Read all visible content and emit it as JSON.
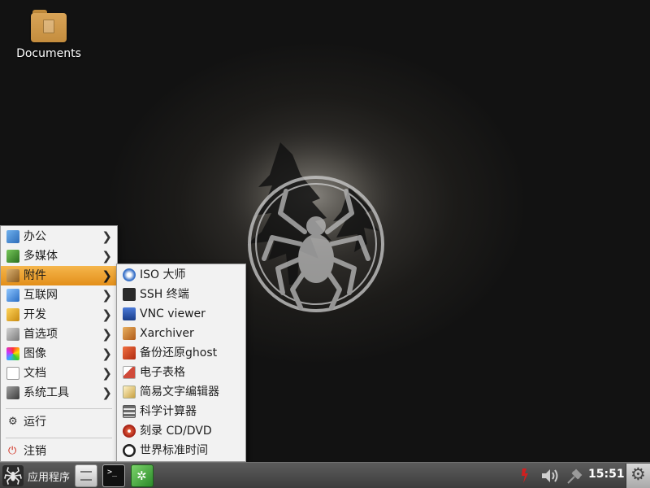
{
  "desktop": {
    "icons": [
      {
        "label": "Documents",
        "icon": "folder-icon"
      }
    ]
  },
  "main_menu": {
    "items": [
      {
        "label": "办公",
        "icon": "office-icon",
        "color": "#3a7bc8",
        "has_submenu": true
      },
      {
        "label": "多媒体",
        "icon": "multimedia-icon",
        "color": "#3a8a2e",
        "has_submenu": true
      },
      {
        "label": "附件",
        "icon": "accessories-icon",
        "color": "#9a6a2a",
        "has_submenu": true,
        "active": true
      },
      {
        "label": "互联网",
        "icon": "internet-icon",
        "color": "#3b86d6",
        "has_submenu": true
      },
      {
        "label": "开发",
        "icon": "development-icon",
        "color": "#e0a020",
        "has_submenu": true
      },
      {
        "label": "首选项",
        "icon": "preferences-icon",
        "color": "#8a8a8a",
        "has_submenu": true
      },
      {
        "label": "图像",
        "icon": "graphics-icon",
        "color": "#c83ad0",
        "has_submenu": true
      },
      {
        "label": "文档",
        "icon": "documents-icon",
        "color": "#bdbdbd",
        "has_submenu": true
      },
      {
        "label": "系统工具",
        "icon": "system-tools-icon",
        "color": "#555555",
        "has_submenu": true
      }
    ],
    "run": {
      "label": "运行",
      "icon": "gear-icon"
    },
    "logout": {
      "label": "注销",
      "icon": "power-icon"
    }
  },
  "submenu": {
    "items": [
      {
        "label": "ISO 大师",
        "icon": "iso-master-icon",
        "color": "#3a72c8"
      },
      {
        "label": "SSH 终端",
        "icon": "ssh-terminal-icon",
        "color": "#333333"
      },
      {
        "label": "VNC viewer",
        "icon": "vnc-viewer-icon",
        "color": "#1f4fa8"
      },
      {
        "label": "Xarchiver",
        "icon": "xarchiver-icon",
        "color": "#c06020"
      },
      {
        "label": "备份还原ghost",
        "icon": "ghost-backup-icon",
        "color": "#d04020"
      },
      {
        "label": "电子表格",
        "icon": "spreadsheet-icon",
        "color": "#d04a3a"
      },
      {
        "label": "简易文字编辑器",
        "icon": "text-editor-icon",
        "color": "#b08a30"
      },
      {
        "label": "科学计算器",
        "icon": "calculator-icon",
        "color": "#6a6a6a"
      },
      {
        "label": "刻录 CD/DVD",
        "icon": "cd-burner-icon",
        "color": "#c83020"
      },
      {
        "label": "世界标准时间",
        "icon": "clock-icon",
        "color": "#222222"
      }
    ]
  },
  "taskbar": {
    "start_label": "应用程序",
    "launchers": [
      {
        "icon": "file-manager-icon"
      },
      {
        "icon": "terminal-icon"
      },
      {
        "icon": "browser-icon"
      }
    ],
    "tray": [
      {
        "icon": "network-icon"
      },
      {
        "icon": "volume-icon"
      },
      {
        "icon": "satellite-icon"
      }
    ],
    "clock": "15:51",
    "settings_icon": "settings-icon"
  },
  "colors": {
    "accent": "#e8961e",
    "menu_bg": "#f2f2f2",
    "taskbar_bg": "#4a4a4a"
  }
}
